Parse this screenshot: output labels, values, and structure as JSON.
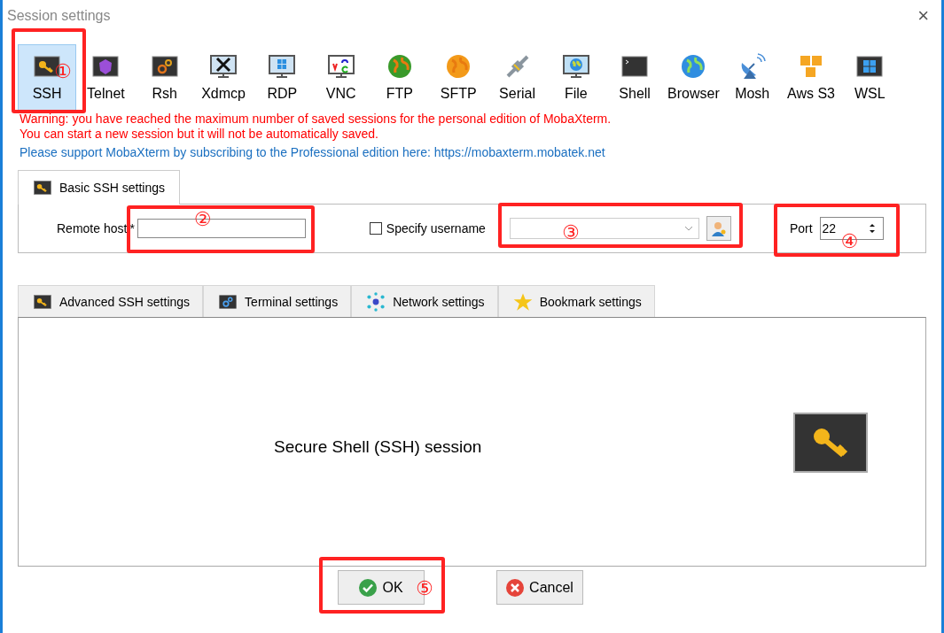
{
  "window": {
    "title": "Session settings",
    "close": "×"
  },
  "session_types": [
    {
      "label": "SSH",
      "selected": true,
      "annotation": "①"
    },
    {
      "label": "Telnet",
      "selected": false
    },
    {
      "label": "Rsh",
      "selected": false
    },
    {
      "label": "Xdmcp",
      "selected": false
    },
    {
      "label": "RDP",
      "selected": false
    },
    {
      "label": "VNC",
      "selected": false
    },
    {
      "label": "FTP",
      "selected": false
    },
    {
      "label": "SFTP",
      "selected": false
    },
    {
      "label": "Serial",
      "selected": false
    },
    {
      "label": "File",
      "selected": false
    },
    {
      "label": "Shell",
      "selected": false
    },
    {
      "label": "Browser",
      "selected": false
    },
    {
      "label": "Mosh",
      "selected": false
    },
    {
      "label": "Aws S3",
      "selected": false
    },
    {
      "label": "WSL",
      "selected": false
    }
  ],
  "warning": [
    "Warning: you have reached the maximum number of saved sessions for the personal edition of MobaXterm.",
    "You can start a new session but it will not be automatically saved."
  ],
  "support": {
    "text": "Please support MobaXterm by subscribing to the Professional edition here: ",
    "link": "https://mobaxterm.mobatek.net"
  },
  "basic_tab": {
    "label": "Basic SSH settings",
    "selected": true
  },
  "basic": {
    "remote_host": {
      "label": "Remote host",
      "required": "*",
      "annotation": "②"
    },
    "username": {
      "label": "Specify username",
      "checked": false,
      "annotation": "③"
    },
    "port": {
      "label": "Port",
      "value": "22",
      "annotation": "④"
    }
  },
  "advanced_tabs": [
    {
      "label": "Advanced SSH settings",
      "selected": false
    },
    {
      "label": "Terminal settings",
      "selected": false
    },
    {
      "label": "Network settings",
      "selected": false
    },
    {
      "label": "Bookmark settings",
      "selected": false
    }
  ],
  "panel": {
    "title": "Secure Shell (SSH) session"
  },
  "buttons": [
    {
      "label": "OK",
      "kind": "ok",
      "annotation": "⑤"
    },
    {
      "label": "Cancel",
      "kind": "cancel"
    }
  ]
}
